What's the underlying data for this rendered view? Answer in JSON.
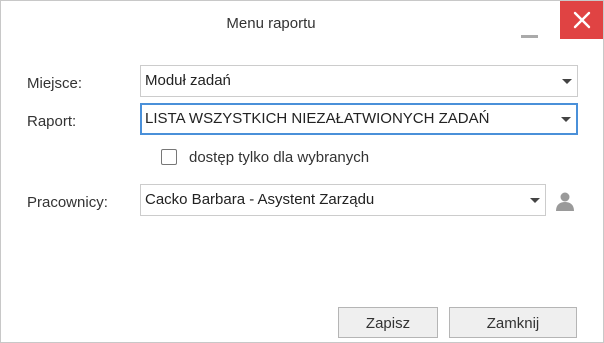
{
  "dialog": {
    "title": "Menu raportu"
  },
  "form": {
    "place": {
      "label": "Miejsce:",
      "value": "Moduł zadań"
    },
    "report": {
      "label": "Raport:",
      "value": "LISTA WSZYSTKICH NIEZAŁATWIONYCH ZADAŃ"
    },
    "restrict_access": {
      "label": "dostęp tylko dla wybranych",
      "checked": false
    },
    "employees": {
      "label": "Pracownicy:",
      "value": "Cacko Barbara - Asystent Zarządu"
    }
  },
  "buttons": {
    "save": "Zapisz",
    "close": "Zamknij"
  },
  "icons": {
    "minimize": "minimize-icon",
    "close": "close-icon",
    "user": "user-icon",
    "dropdown": "chevron-down-icon"
  },
  "colors": {
    "close_button": "#e04343",
    "report_field_border": "#4a90d9"
  }
}
